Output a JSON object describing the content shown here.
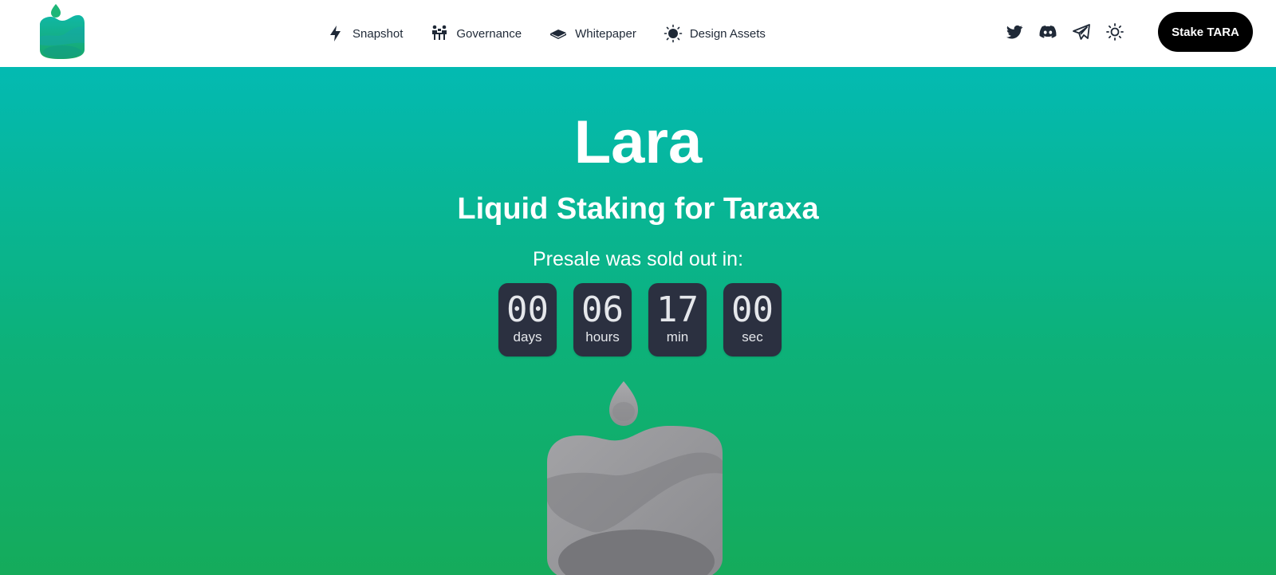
{
  "header": {
    "logo_alt": "Lara logo",
    "nav": [
      {
        "label": "Snapshot",
        "icon": "lightning-icon"
      },
      {
        "label": "Governance",
        "icon": "governance-icon"
      },
      {
        "label": "Whitepaper",
        "icon": "book-icon"
      },
      {
        "label": "Design Assets",
        "icon": "sun-dark-icon"
      }
    ],
    "social": [
      {
        "name": "twitter",
        "icon": "twitter-icon"
      },
      {
        "name": "discord",
        "icon": "discord-icon"
      },
      {
        "name": "telegram",
        "icon": "telegram-icon"
      },
      {
        "name": "theme-toggle",
        "icon": "sun-icon"
      }
    ],
    "cta_label": "Stake TARA"
  },
  "hero": {
    "title": "Lara",
    "subtitle": "Liquid Staking for Taraxa",
    "presale_label": "Presale was sold out in:",
    "countdown": [
      {
        "value": "00",
        "unit": "days"
      },
      {
        "value": "06",
        "unit": "hours"
      },
      {
        "value": "17",
        "unit": "min"
      },
      {
        "value": "00",
        "unit": "sec"
      }
    ]
  },
  "colors": {
    "hero_top": "#03bab2",
    "hero_bottom": "#15ab5b",
    "countdown_bg": "#2b3040",
    "cta_bg": "#000000",
    "nav_text": "#1f2937"
  }
}
